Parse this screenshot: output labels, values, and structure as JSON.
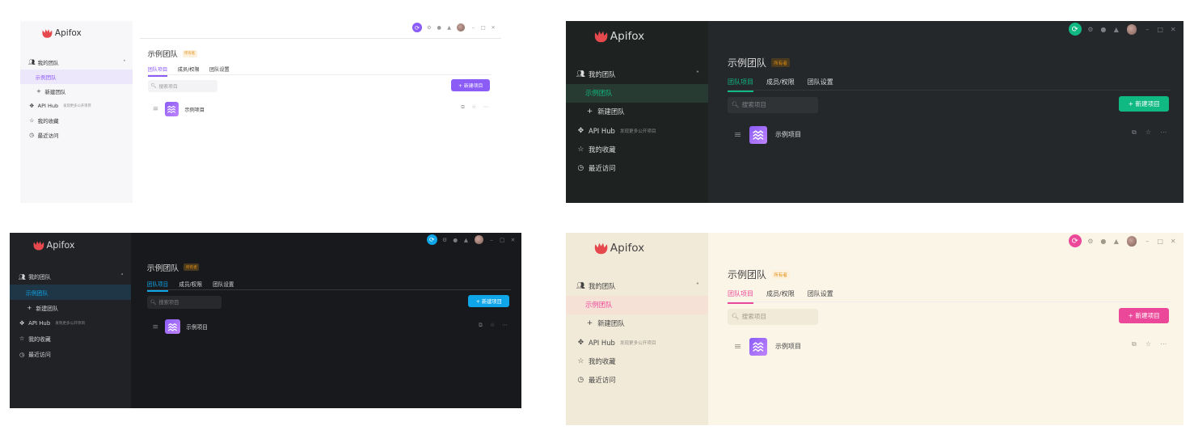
{
  "app": {
    "logo_text": "Apifox",
    "nav": {
      "my_team": "我的团队",
      "sample_team": "示例团队",
      "new_team": "新建团队",
      "api_hub": "API Hub",
      "api_hub_sub": "发现更多公开项目",
      "favorites": "我的收藏",
      "recent": "最近访问"
    },
    "team_title": "示例团队",
    "owner_badge": "所有者",
    "tabs": [
      "团队项目",
      "成员/权限",
      "团队设置"
    ],
    "search_placeholder": "搜索项目",
    "new_project_label": "+ 新建项目",
    "project_name": "示例项目",
    "icons": {
      "sync": "sync-icon",
      "settings": "gear-icon",
      "help": "help-icon",
      "notify": "bell-icon",
      "minimize": "minimize-icon",
      "maximize": "maximize-icon",
      "close": "close-icon"
    }
  },
  "themes": [
    {
      "name": "light-purple",
      "accent": "#8b5cf6",
      "sidebar_bg": "#f7f7f9",
      "main_bg": "#ffffff",
      "text": "#333333",
      "muted": "#9a9a9a",
      "active_item_bg": "#ede7fb",
      "active_item_text": "#8b5cf6",
      "search_bg": "#f3f3f5"
    },
    {
      "name": "dark-green",
      "accent": "#10b981",
      "sidebar_bg": "#1e2321",
      "main_bg": "#25282b",
      "text": "#dcdcdc",
      "muted": "#7d8185",
      "active_item_bg": "#283b33",
      "active_item_text": "#10b981",
      "search_bg": "#2f3336"
    },
    {
      "name": "dark-blue",
      "accent": "#0ea5e9",
      "sidebar_bg": "#202226",
      "main_bg": "#18191c",
      "text": "#d6d6d6",
      "muted": "#7a7c80",
      "active_item_bg": "#1f3647",
      "active_item_text": "#0ea5e9",
      "search_bg": "#27292d"
    },
    {
      "name": "warm-pink",
      "accent": "#ec4899",
      "sidebar_bg": "#f2ead8",
      "main_bg": "#fbf5e8",
      "text": "#444444",
      "muted": "#a19a8a",
      "active_item_bg": "#f6e1d7",
      "active_item_text": "#ec4899",
      "search_bg": "#f1ead9"
    }
  ]
}
